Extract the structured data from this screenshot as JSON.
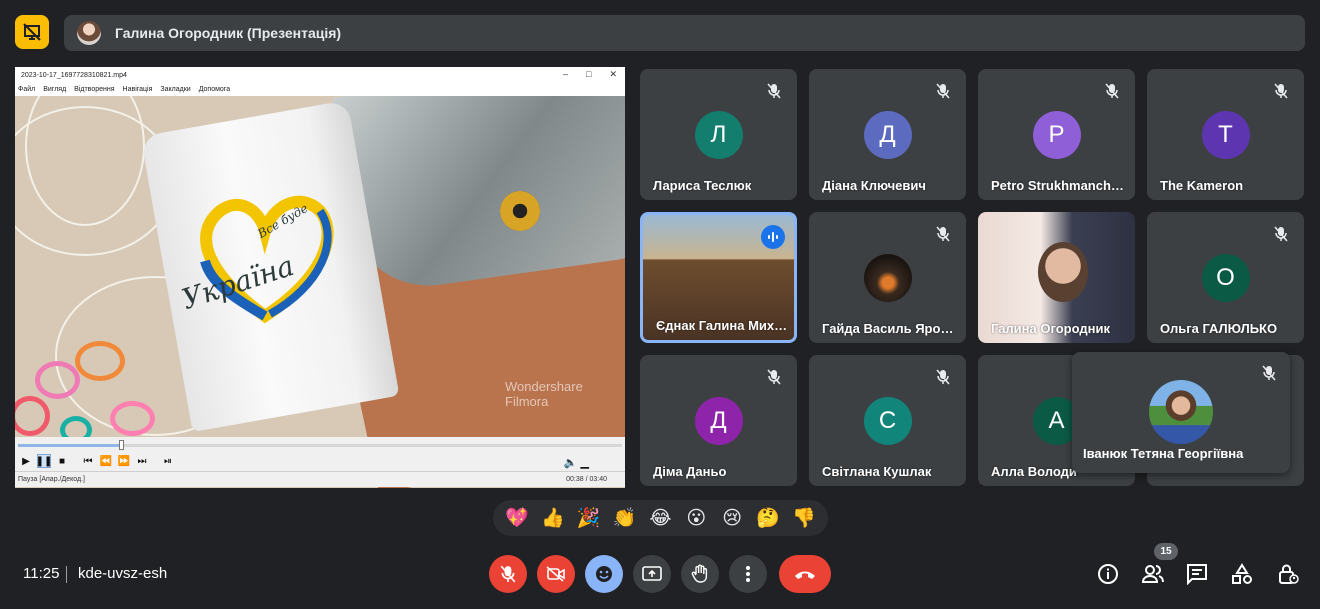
{
  "presenting": {
    "presenter_label": "Галина Огородник (Презентація)"
  },
  "player": {
    "title": "2023-10-17_1697728310821.mp4",
    "menu": [
      "Файл",
      "Вигляд",
      "Відтворення",
      "Навігація",
      "Закладки",
      "Допомога"
    ],
    "status": "Пауза [Апар./Декод.]",
    "time": "00:38 / 03:40",
    "progress": 0.17,
    "watermark_line1": "Wondershare",
    "watermark_line2": "Filmora",
    "cup_text_main": "Україна",
    "cup_text_small": "Все буде"
  },
  "participants": [
    {
      "name": "Лариса Теслюк",
      "initial": "Л",
      "color": "#137e6e",
      "muted": true
    },
    {
      "name": "Діана Ключевич",
      "initial": "Д",
      "color": "#5c6bc0",
      "muted": true
    },
    {
      "name": "Petro Strukhmanch…",
      "initial": "P",
      "color": "#8e5fd6",
      "muted": true
    },
    {
      "name": "The Kameron",
      "initial": "T",
      "color": "#5e35b1",
      "muted": true
    },
    {
      "name": "Єднак Галина Мих…",
      "speaking": true
    },
    {
      "name": "Гайда Василь Яро…",
      "muted": true
    },
    {
      "name": "Галина Огородник",
      "muted": false
    },
    {
      "name": "Ольга ГАЛЮЛЬКО",
      "initial": "О",
      "color": "#0b5a46",
      "muted": true
    },
    {
      "name": "Діма Даньо",
      "initial": "Д",
      "color": "#8e24aa",
      "muted": true
    },
    {
      "name": "Світлана Кушлак",
      "initial": "С",
      "color": "#12857a",
      "muted": true
    },
    {
      "name": "Алла Володи",
      "initial": "А",
      "color": "#0b5a46",
      "muted": true
    }
  ],
  "floating_tile": {
    "name": "Іванюк Тетяна Георгіївна",
    "muted": true
  },
  "reactions": [
    "💖",
    "👍",
    "🎉",
    "👏",
    "😂",
    "😮",
    "😢",
    "🤔",
    "👎"
  ],
  "bottom": {
    "time": "11:25",
    "meeting_code": "kde-uvsz-esh",
    "people_count": "15"
  }
}
